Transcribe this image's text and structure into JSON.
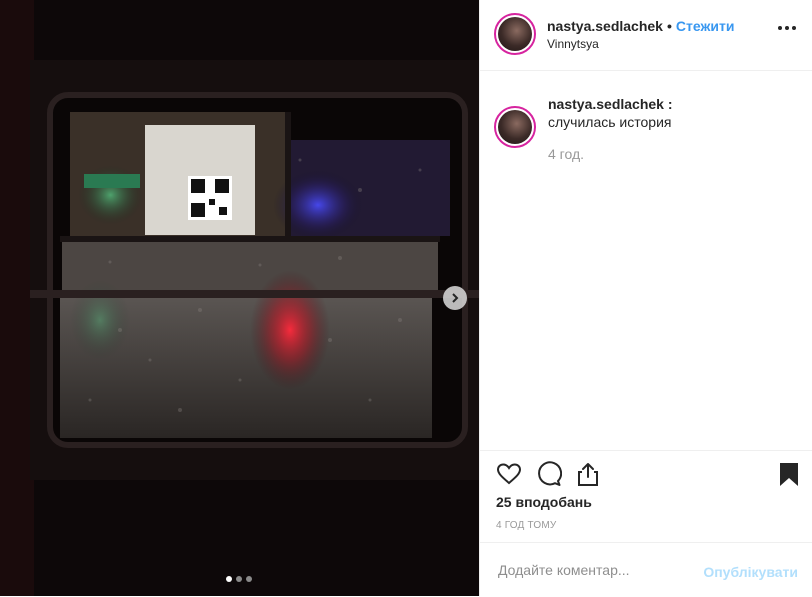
{
  "post": {
    "username": "nastya.sedlachek",
    "separator": "•",
    "follow_label": "Стежити",
    "location": "Vinnytsya",
    "more_icon": "more-options-icon",
    "image_description_icon": "photo-rain-window",
    "carousel": {
      "current_index": 1,
      "total": 3
    }
  },
  "caption": {
    "username": "nastya.sedlachek :",
    "text": "случилась история",
    "time": "4 год."
  },
  "actions": {
    "like_icon": "heart-icon",
    "comment_icon": "comment-icon",
    "share_icon": "share-icon",
    "save_icon": "bookmark-icon"
  },
  "likes_label": "25 вподобань",
  "posted_ago": "4 ГОД ТОМУ",
  "comment_box": {
    "placeholder": "Додайте коментар...",
    "publish_label": "Опублікувати"
  },
  "colors": {
    "accent": "#3897f0",
    "publish_disabled": "#b2dffc",
    "avatar_ring": "#d6249f"
  }
}
